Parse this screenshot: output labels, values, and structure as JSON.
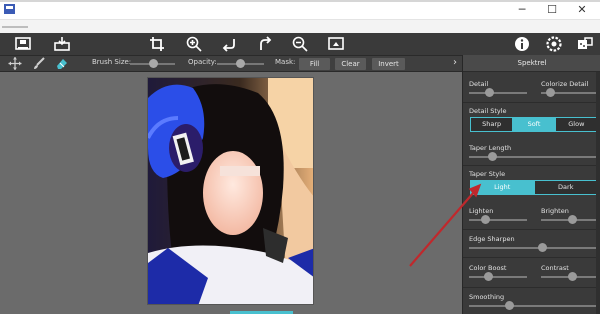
{
  "window": {
    "controls": {
      "minimize": "─",
      "maximize": "☐",
      "close": "✕"
    }
  },
  "toolbar": {
    "icons": [
      "save-icon",
      "open-icon",
      "crop-icon",
      "zoom-in-icon",
      "undo-icon",
      "redo-icon",
      "zoom-out-icon",
      "fit-icon",
      "info-icon",
      "settings-icon",
      "plugins-icon"
    ]
  },
  "options": {
    "brush_size_label": "Brush Size:",
    "brush_size_value": 0.35,
    "opacity_label": "Opacity:",
    "opacity_value": 0.5,
    "mask_label": "Mask:",
    "fill_label": "Fill",
    "clear_label": "Clear",
    "invert_label": "Invert",
    "expand_arrow": "›"
  },
  "panel": {
    "title": "Spektrel",
    "detail_label": "Detail",
    "detail_value": 0.35,
    "colorize_detail_label": "Colorize Detail",
    "colorize_detail_value": 0.25,
    "detail_style_label": "Detail Style",
    "detail_style_options": [
      "Sharp",
      "Soft",
      "Glow"
    ],
    "detail_style_selected": "Soft",
    "taper_length_label": "Taper Length",
    "taper_length_value": 0.2,
    "taper_style_label": "Taper Style",
    "taper_style_options": [
      "Light",
      "Dark"
    ],
    "taper_style_selected": "Light",
    "lighten_label": "Lighten",
    "lighten_value": 0.25,
    "brighten_label": "Brighten",
    "brighten_value": 0.55,
    "edge_sharpen_label": "Edge Sharpen",
    "edge_sharpen_value": 0.58,
    "color_boost_label": "Color Boost",
    "color_boost_value": 0.3,
    "contrast_label": "Contrast",
    "contrast_value": 0.55,
    "smoothing_label": "Smoothing",
    "smoothing_value": 0.3
  },
  "colors": {
    "accent": "#48c0cf",
    "annotation_arrow": "#c0282c",
    "panel_bg": "#3a3a3a",
    "canvas_bg": "#6b6b6b"
  }
}
